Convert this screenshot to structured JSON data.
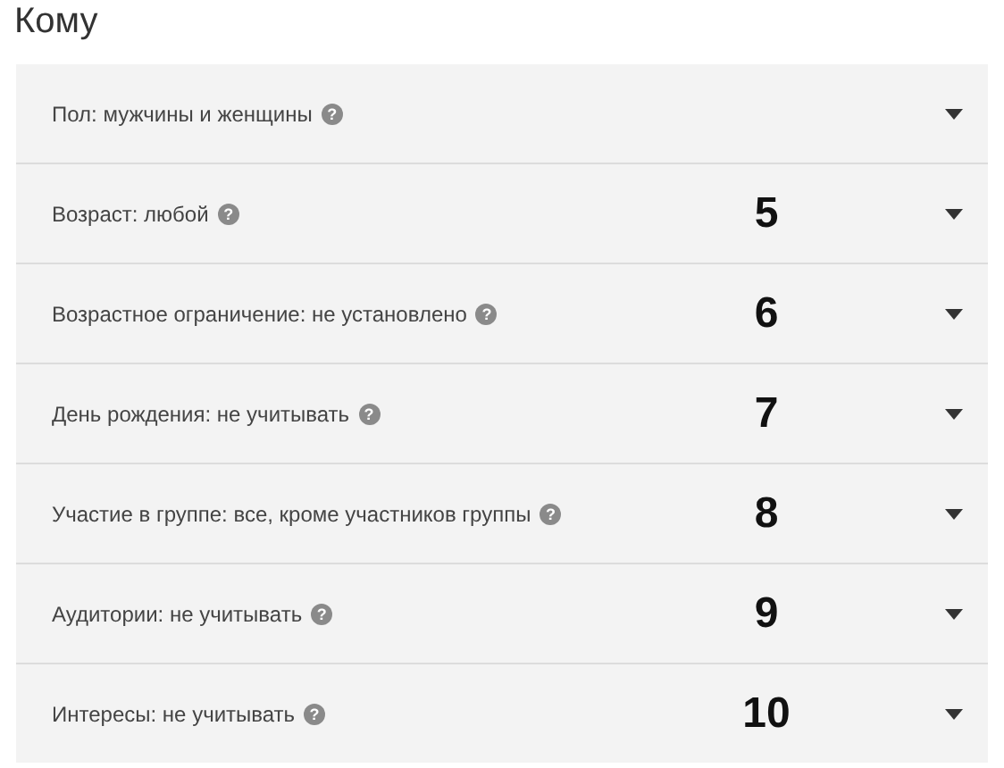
{
  "title": "Кому",
  "rows": [
    {
      "label": "Пол: мужчины и женщины",
      "help": "?"
    },
    {
      "label": "Возраст: любой",
      "help": "?",
      "marker": "5"
    },
    {
      "label": "Возрастное ограничение: не установлено",
      "help": "?",
      "marker": "6"
    },
    {
      "label": "День рождения: не учитывать",
      "help": "?",
      "marker": "7"
    },
    {
      "label": "Участие в группе: все, кроме участников группы",
      "help": "?",
      "marker": "8"
    },
    {
      "label": "Аудитории: не учитывать",
      "help": "?",
      "marker": "9"
    },
    {
      "label": "Интересы: не учитывать",
      "help": "?",
      "marker": "10"
    }
  ]
}
